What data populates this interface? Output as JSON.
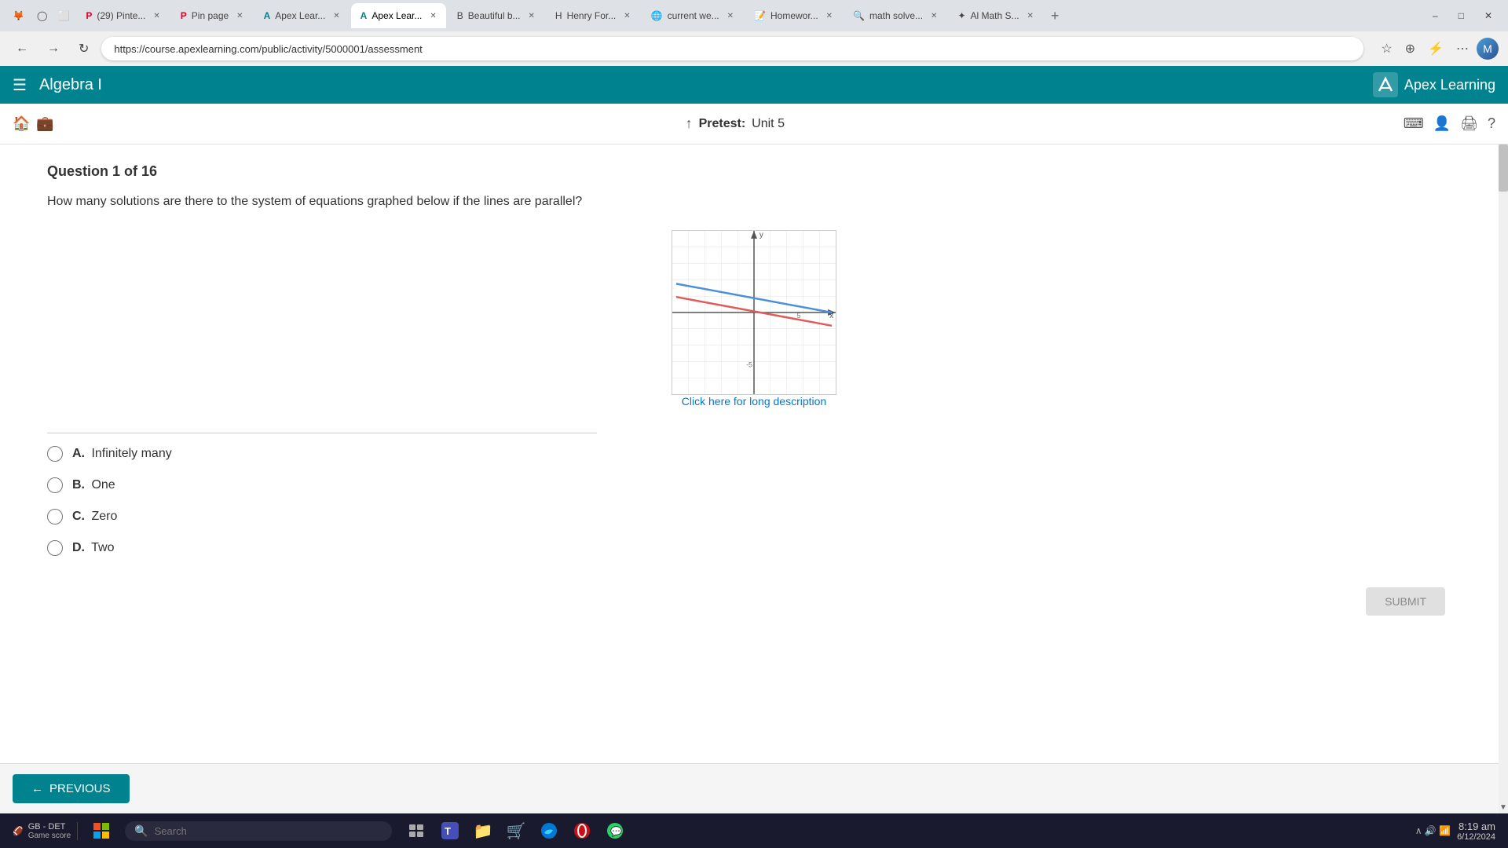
{
  "browser": {
    "url": "https://course.apexlearning.com/public/activity/5000001/assessment",
    "tabs": [
      {
        "id": "firefox",
        "favicon": "🦊",
        "label": "Firefox",
        "active": false
      },
      {
        "id": "circle",
        "favicon": "○",
        "label": "",
        "active": false
      },
      {
        "id": "square",
        "favicon": "□",
        "label": "",
        "active": false
      },
      {
        "id": "pinterest1",
        "favicon": "P",
        "label": "(29) Pinte...",
        "active": false
      },
      {
        "id": "pinpage",
        "favicon": "P",
        "label": "Pin page",
        "active": false
      },
      {
        "id": "apexlearn1",
        "favicon": "A",
        "label": "Apex Lear...",
        "active": false
      },
      {
        "id": "apexlearn2",
        "favicon": "A",
        "label": "Apex Lear...",
        "active": true
      },
      {
        "id": "beautiful",
        "favicon": "B",
        "label": "Beautiful b...",
        "active": false
      },
      {
        "id": "henryford",
        "favicon": "H",
        "label": "Henry For...",
        "active": false
      },
      {
        "id": "currentwe",
        "favicon": "C",
        "label": "current we...",
        "active": false
      },
      {
        "id": "homework",
        "favicon": "H",
        "label": "Homewor...",
        "active": false
      },
      {
        "id": "mathsolve",
        "favicon": "M",
        "label": "math solve...",
        "active": false
      },
      {
        "id": "aimath",
        "favicon": "A",
        "label": "Al Math S...",
        "active": false
      }
    ],
    "nav": {
      "back": "←",
      "forward": "→",
      "refresh": "↻"
    }
  },
  "app": {
    "title": "Algebra I",
    "logo": "Apex Learning",
    "pretest_label": "Pretest:",
    "pretest_unit": "Unit 5"
  },
  "question": {
    "number": "Question 1 of 16",
    "text": "How many solutions are there to the system of equations graphed below if the lines are parallel?",
    "long_desc_link": "Click here for long description",
    "choices": [
      {
        "letter": "A.",
        "text": "Infinitely many"
      },
      {
        "letter": "B.",
        "text": "One"
      },
      {
        "letter": "C.",
        "text": "Zero"
      },
      {
        "letter": "D.",
        "text": "Two"
      }
    ]
  },
  "navigation": {
    "previous_btn": "PREVIOUS",
    "submit_btn": "SUBMIT"
  },
  "taskbar": {
    "search_placeholder": "Search",
    "game_label": "GB - DET",
    "game_sub": "Game score",
    "time": "8:19 am",
    "date": "6/12/2024"
  }
}
